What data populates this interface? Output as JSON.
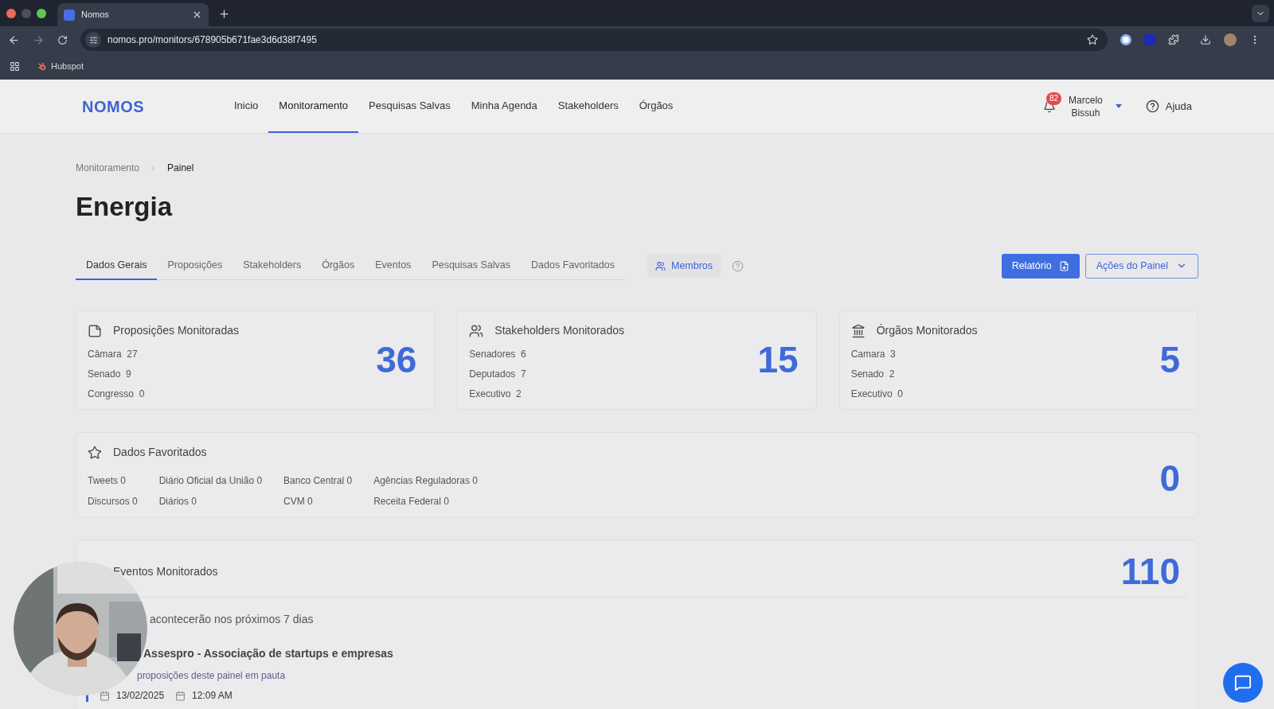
{
  "browser": {
    "tab_title": "Nomos",
    "url": "nomos.pro/monitors/678905b671fae3d6d38f7495",
    "bookmark": "Hubspot"
  },
  "nav": {
    "logo": "NOMOS",
    "items": [
      {
        "label": "Inicio",
        "selected": false
      },
      {
        "label": "Monitoramento",
        "selected": true
      },
      {
        "label": "Pesquisas Salvas",
        "selected": false
      },
      {
        "label": "Minha Agenda",
        "selected": false
      },
      {
        "label": "Stakeholders",
        "selected": false
      },
      {
        "label": "Órgãos",
        "selected": false
      }
    ],
    "notifications": "82",
    "user": [
      "Marcelo",
      "Bissuh"
    ],
    "help": "Ajuda"
  },
  "breadcrumb": [
    {
      "label": "Monitoramento"
    },
    {
      "label": "Painel"
    }
  ],
  "title": "Energia",
  "tabs": [
    {
      "label": "Dados Gerais",
      "selected": true
    },
    {
      "label": "Proposições",
      "selected": false
    },
    {
      "label": "Stakeholders",
      "selected": false
    },
    {
      "label": "Órgãos",
      "selected": false
    },
    {
      "label": "Eventos",
      "selected": false
    },
    {
      "label": "Pesquisas Salvas",
      "selected": false
    },
    {
      "label": "Dados Favoritados",
      "selected": false
    }
  ],
  "members_button": "Membros",
  "report_button": "Relatório",
  "actions_button": "Ações do Painel",
  "cards": [
    {
      "kind": "document",
      "title": "Proposições Monitoradas",
      "rows": [
        {
          "label": "Câmara",
          "value": "27"
        },
        {
          "label": "Senado",
          "value": "9"
        },
        {
          "label": "Congresso",
          "value": "0"
        }
      ],
      "total": "36"
    },
    {
      "kind": "people",
      "title": "Stakeholders Monitorados",
      "rows": [
        {
          "label": "Senadores",
          "value": "6"
        },
        {
          "label": "Deputados",
          "value": "7"
        },
        {
          "label": "Executivo",
          "value": "2"
        }
      ],
      "total": "15"
    },
    {
      "kind": "building",
      "title": "Órgãos Monitorados",
      "rows": [
        {
          "label": "Camara",
          "value": "3"
        },
        {
          "label": "Senado",
          "value": "2"
        },
        {
          "label": "Executivo",
          "value": "0"
        }
      ],
      "total": "5"
    }
  ],
  "favorites": {
    "title": "Dados Favoritados",
    "columns": [
      [
        "Tweets 0",
        "Discursos 0"
      ],
      [
        "Diário Oficial da União 0",
        "Diários 0"
      ],
      [
        "Banco Central 0",
        "CVM 0"
      ],
      [
        "Agências Reguladoras 0",
        "Receita Federal 0"
      ]
    ],
    "total": "0"
  },
  "events": {
    "title": "Eventos Monitorados",
    "total": "110",
    "subtitle": "acontecerão nos próximos 7 dias",
    "event": {
      "title": "Assespro - Associação de startups e empresas",
      "note": "proposições deste painel em pauta",
      "date": "13/02/2025",
      "time": "12:09 AM"
    }
  }
}
